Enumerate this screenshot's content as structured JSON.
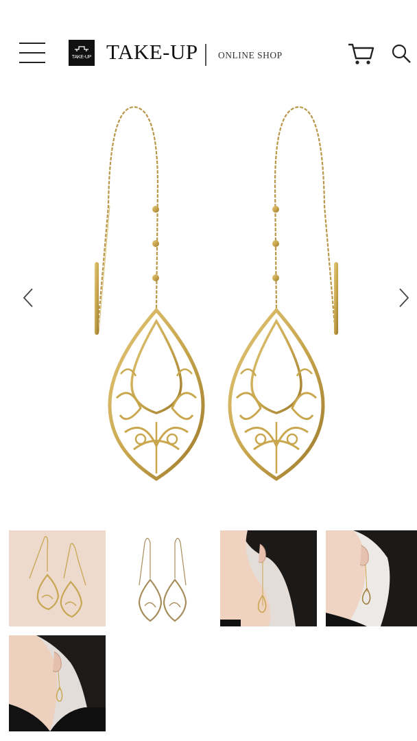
{
  "header": {
    "logo_mini": "TAKE-UP",
    "brand": "TAKE-UP",
    "shop_label": "ONLINE SHOP"
  },
  "colors": {
    "gold": "#c9a74e",
    "gold_dark": "#9c7a2c",
    "thumb_beige": "#eed9cd",
    "thumb_grey": "#e9e6e3",
    "dark_hair": "#1c1a19",
    "skin": "#f0d2c0"
  },
  "icons": [
    "hamburger-menu-icon",
    "cart-icon",
    "search-icon",
    "chevron-left-icon",
    "chevron-right-icon"
  ],
  "gallery": {
    "thumbnail_count": 5,
    "thumbnails": [
      "earrings-on-beige",
      "earrings-on-white",
      "model-side-view-1",
      "model-side-view-2",
      "model-side-view-3"
    ]
  }
}
